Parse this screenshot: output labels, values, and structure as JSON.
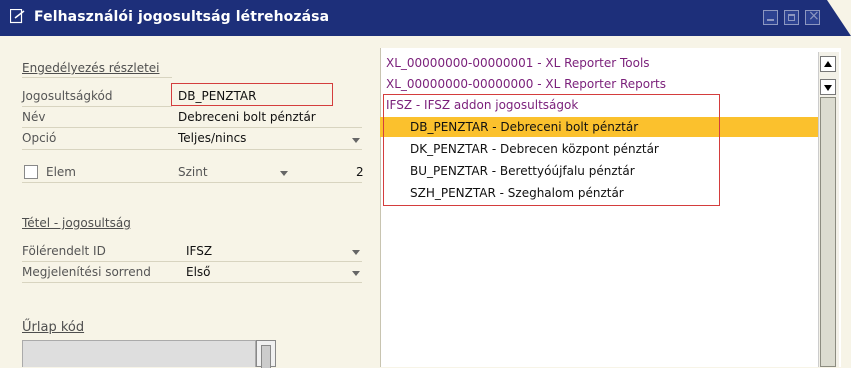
{
  "window": {
    "title": "Felhasználói jogosultság létrehozása",
    "icon": "edit-form-icon",
    "controls": [
      "minimize-icon",
      "maximize-icon",
      "close-icon"
    ]
  },
  "form": {
    "section_details": "Engedélyezés részletei",
    "auth_code_label": "Jogosultságkód",
    "auth_code_value": "DB_PENZTAR",
    "name_label": "Név",
    "name_value": "Debreceni bolt pénztár",
    "option_label": "Opció",
    "option_value": "Teljes/nincs",
    "element_label": "Elem",
    "level_label": "Szint",
    "level_value": "2",
    "section_item": "Tétel - jogosultság",
    "parent_id_label": "Fölérendelt ID",
    "parent_id_value": "IFSZ",
    "display_order_label": "Megjelenítési sorrend",
    "display_order_value": "Első",
    "form_code_label": "Űrlap kód"
  },
  "tree": {
    "items": [
      {
        "text": "XL_00000000-00000001 - XL Reporter Tools",
        "color": "#7a1f7a"
      },
      {
        "text": "XL_00000000-00000000 - XL Reporter Reports",
        "color": "#7a1f7a"
      },
      {
        "text": "IFSZ - IFSZ addon jogosultságok",
        "color": "#7a1f7a"
      },
      {
        "text": "DB_PENZTAR - Debreceni bolt pénztár",
        "color": "#111111",
        "selected": true
      },
      {
        "text": "DK_PENZTAR - Debrecen központ pénztár",
        "color": "#111111"
      },
      {
        "text": "BU_PENZTAR - Berettyóújfalu pénztár",
        "color": "#111111"
      },
      {
        "text": "SZH_PENZTAR - Szeghalom pénztár",
        "color": "#111111"
      }
    ]
  },
  "colors": {
    "titlebar": "#1d2f7a",
    "selection": "#fbc12d",
    "highlight_box": "#d43d3d",
    "background": "#f7f4e7"
  }
}
